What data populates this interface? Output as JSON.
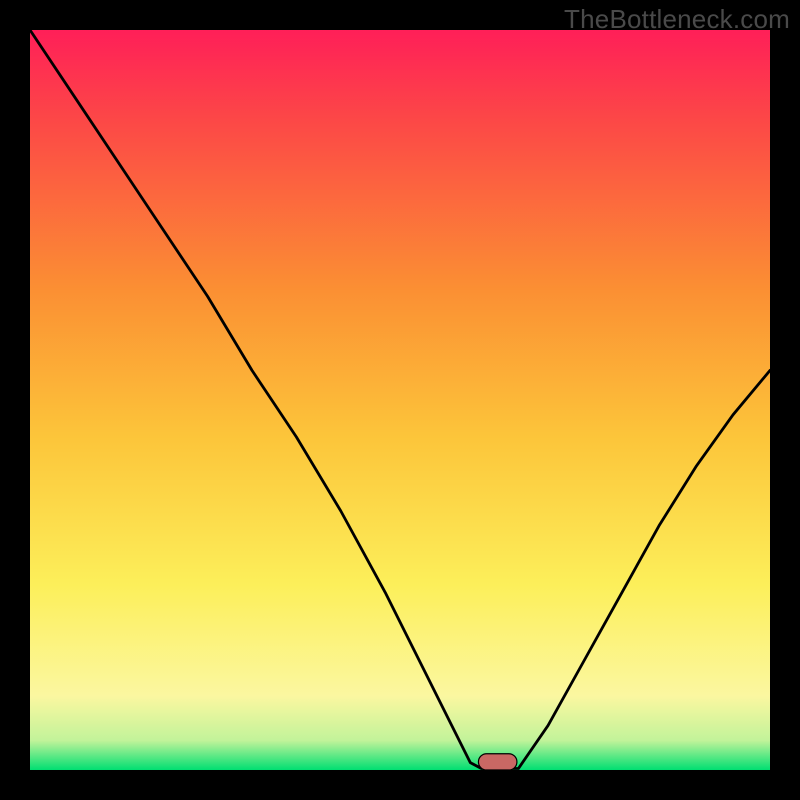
{
  "watermark": "TheBottleneck.com",
  "chart_data": {
    "type": "line",
    "title": "",
    "xlabel": "",
    "ylabel": "",
    "xlim": [
      0,
      100
    ],
    "ylim": [
      0,
      100
    ],
    "gradient_stops": [
      {
        "offset": 0.0,
        "color": "#00df72"
      },
      {
        "offset": 0.04,
        "color": "#c2f39a"
      },
      {
        "offset": 0.1,
        "color": "#fbf7a0"
      },
      {
        "offset": 0.25,
        "color": "#fcef5a"
      },
      {
        "offset": 0.45,
        "color": "#fcc53a"
      },
      {
        "offset": 0.65,
        "color": "#fb8f33"
      },
      {
        "offset": 0.88,
        "color": "#fc4747"
      },
      {
        "offset": 1.0,
        "color": "#ff1f58"
      }
    ],
    "series": [
      {
        "name": "bottleneck-curve-left",
        "x": [
          0.0,
          8.0,
          16.0,
          24.0,
          30.0,
          36.0,
          42.0,
          48.0,
          53.0,
          57.0,
          59.5,
          61.0
        ],
        "values": [
          100.0,
          88.0,
          76.0,
          64.0,
          54.0,
          45.0,
          35.0,
          24.0,
          14.0,
          6.0,
          1.0,
          0.2
        ]
      },
      {
        "name": "flat-min",
        "x": [
          61.0,
          66.0
        ],
        "values": [
          0.2,
          0.2
        ]
      },
      {
        "name": "bottleneck-curve-right",
        "x": [
          66.0,
          70.0,
          75.0,
          80.0,
          85.0,
          90.0,
          95.0,
          100.0
        ],
        "values": [
          0.2,
          6.0,
          15.0,
          24.0,
          33.0,
          41.0,
          48.0,
          54.0
        ]
      }
    ],
    "marker": {
      "name": "optimal-range",
      "shape": "rounded-rect",
      "x_center": 63.2,
      "y": 0.0,
      "width": 5.2,
      "height": 2.2,
      "fill": "#c96864",
      "stroke": "#000000"
    }
  }
}
